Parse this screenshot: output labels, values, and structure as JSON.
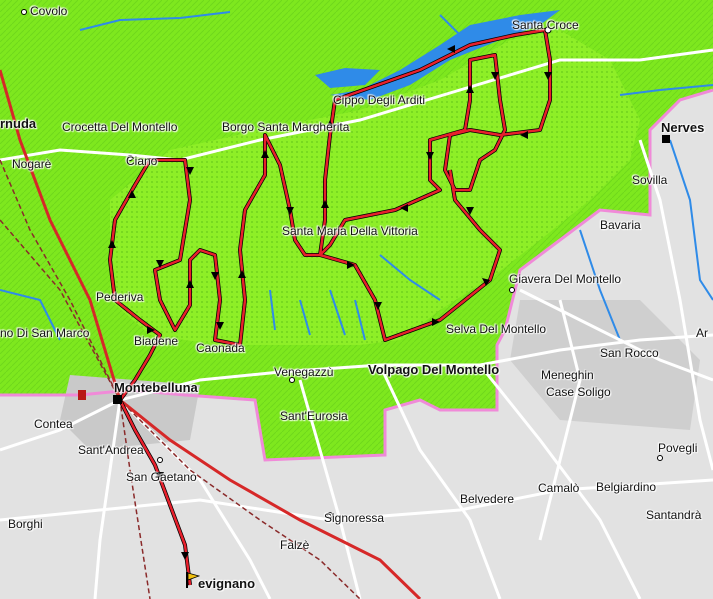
{
  "map": {
    "places": [
      {
        "id": "covolo",
        "label": "Covolo"
      },
      {
        "id": "cornuda",
        "label": "rnuda"
      },
      {
        "id": "crocetta",
        "label": "Crocetta Del Montello"
      },
      {
        "id": "borgo",
        "label": "Borgo Santa Margherita"
      },
      {
        "id": "cippo",
        "label": "Cippo Degli Arditi"
      },
      {
        "id": "santacroce",
        "label": "Santa Croce"
      },
      {
        "id": "nervesa",
        "label": "Nerves"
      },
      {
        "id": "sovilla",
        "label": "Sovilla"
      },
      {
        "id": "bavaria",
        "label": "Bavaria"
      },
      {
        "id": "nogare",
        "label": "Nogarè"
      },
      {
        "id": "ciano",
        "label": "Ciano"
      },
      {
        "id": "smvittoria",
        "label": "Santa Maria Della Vittoria"
      },
      {
        "id": "giavera",
        "label": "Giavera Del Montello"
      },
      {
        "id": "pederiva",
        "label": "Pederiva"
      },
      {
        "id": "sanmarco",
        "label": "no Di San Marco"
      },
      {
        "id": "biadene",
        "label": "Biadene"
      },
      {
        "id": "caonada",
        "label": "Caonada"
      },
      {
        "id": "selva",
        "label": "Selva Del Montello"
      },
      {
        "id": "ar",
        "label": "Ar"
      },
      {
        "id": "sanrocco",
        "label": "San Rocco"
      },
      {
        "id": "montebelluna",
        "label": "Montebelluna"
      },
      {
        "id": "venegazzu",
        "label": "Venegazzù"
      },
      {
        "id": "volpago",
        "label": "Volpago Del Montello"
      },
      {
        "id": "meneghin",
        "label": "Meneghin"
      },
      {
        "id": "casesoligo",
        "label": "Case Soligo"
      },
      {
        "id": "santeurosia",
        "label": "Sant'Eurosia"
      },
      {
        "id": "contea",
        "label": "Contea"
      },
      {
        "id": "santandrea",
        "label": "Sant'Andrea"
      },
      {
        "id": "sangaetano",
        "label": "San Gaetano"
      },
      {
        "id": "povegli",
        "label": "Povegli"
      },
      {
        "id": "belvedere",
        "label": "Belvedere"
      },
      {
        "id": "camalo",
        "label": "Camalò"
      },
      {
        "id": "belgiardino",
        "label": "Belgiardino"
      },
      {
        "id": "borghi",
        "label": "Borghi"
      },
      {
        "id": "signoressa",
        "label": "Signoressa"
      },
      {
        "id": "santandra",
        "label": "Santandrà"
      },
      {
        "id": "falze",
        "label": "Falzè"
      },
      {
        "id": "trevignano",
        "label": "evignano"
      }
    ],
    "colors": {
      "terrain": "#7ee81e",
      "terrain_dark": "#3fa012",
      "water": "#2f8be8",
      "route": "#e8202c",
      "road": "#ffffff",
      "border": "#f08ad8",
      "background": "#e2e2e2"
    },
    "icons": [
      "route-arrow-icon",
      "city-marker-icon",
      "flag-icon"
    ]
  }
}
